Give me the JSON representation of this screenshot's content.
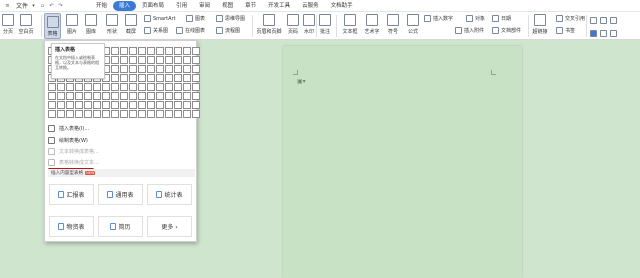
{
  "menubar": {
    "file_label": "文件",
    "tabs": [
      {
        "label": "开始"
      },
      {
        "label": "插入",
        "active": true
      },
      {
        "label": "页面布局"
      },
      {
        "label": "引用"
      },
      {
        "label": "审阅"
      },
      {
        "label": "视图"
      },
      {
        "label": "章节"
      },
      {
        "label": "开发工具"
      },
      {
        "label": "云服务"
      },
      {
        "label": "文档助手"
      }
    ]
  },
  "ribbon": {
    "items": [
      {
        "label": "分页"
      },
      {
        "label": "空白页"
      },
      {
        "label": "表格"
      },
      {
        "label": "图片"
      },
      {
        "label": "图库"
      },
      {
        "label": "形状"
      },
      {
        "label": "截屏"
      }
    ],
    "smartart_label": "SmartArt",
    "chart_label": "图表",
    "relation_label": "关系图",
    "mindmap_label": "思维导图",
    "online_chart_label": "在线图表",
    "flowchart_label": "流程图",
    "header_footer_label": "页眉和页脚",
    "page_number_label": "页码",
    "watermark_label": "水印",
    "comment_label": "批注",
    "textbox_label": "文本框",
    "wordart_label": "艺术字",
    "symbol_label": "符号",
    "formula_label": "公式",
    "insert_number_label": "插入数字",
    "object_label": "对象",
    "date_label": "日期",
    "insert_attachment_label": "插入附件",
    "doc_parts_label": "文档部件",
    "hyperlink_label": "超链接",
    "bookmark_label": "书签",
    "cross_ref_label": "交叉引用"
  },
  "dropdown": {
    "tooltip_title": "插入表格",
    "tooltip_desc": "在文档中插入或绘制表格，以及文本与表格的相互转换。",
    "menu": [
      {
        "label": "插入表格(I)...",
        "disabled": false
      },
      {
        "label": "绘制表格(W)",
        "disabled": false
      },
      {
        "label": "文本转换成表格...",
        "disabled": true
      },
      {
        "label": "表格转换成文本...",
        "disabled": true
      }
    ],
    "section_title": "插入内容型表格",
    "new_badge": "NEW",
    "cards": [
      {
        "label": "汇报表"
      },
      {
        "label": "通用表"
      },
      {
        "label": "统计表"
      },
      {
        "label": "物资表"
      },
      {
        "label": "简历"
      },
      {
        "label": "更多 ›"
      }
    ]
  },
  "colors": {
    "accent": "#3a7bd5",
    "document_bg": "#c8e2c6",
    "workspace_bg": "#cfe5cd",
    "underline_red": "#c0121f"
  }
}
